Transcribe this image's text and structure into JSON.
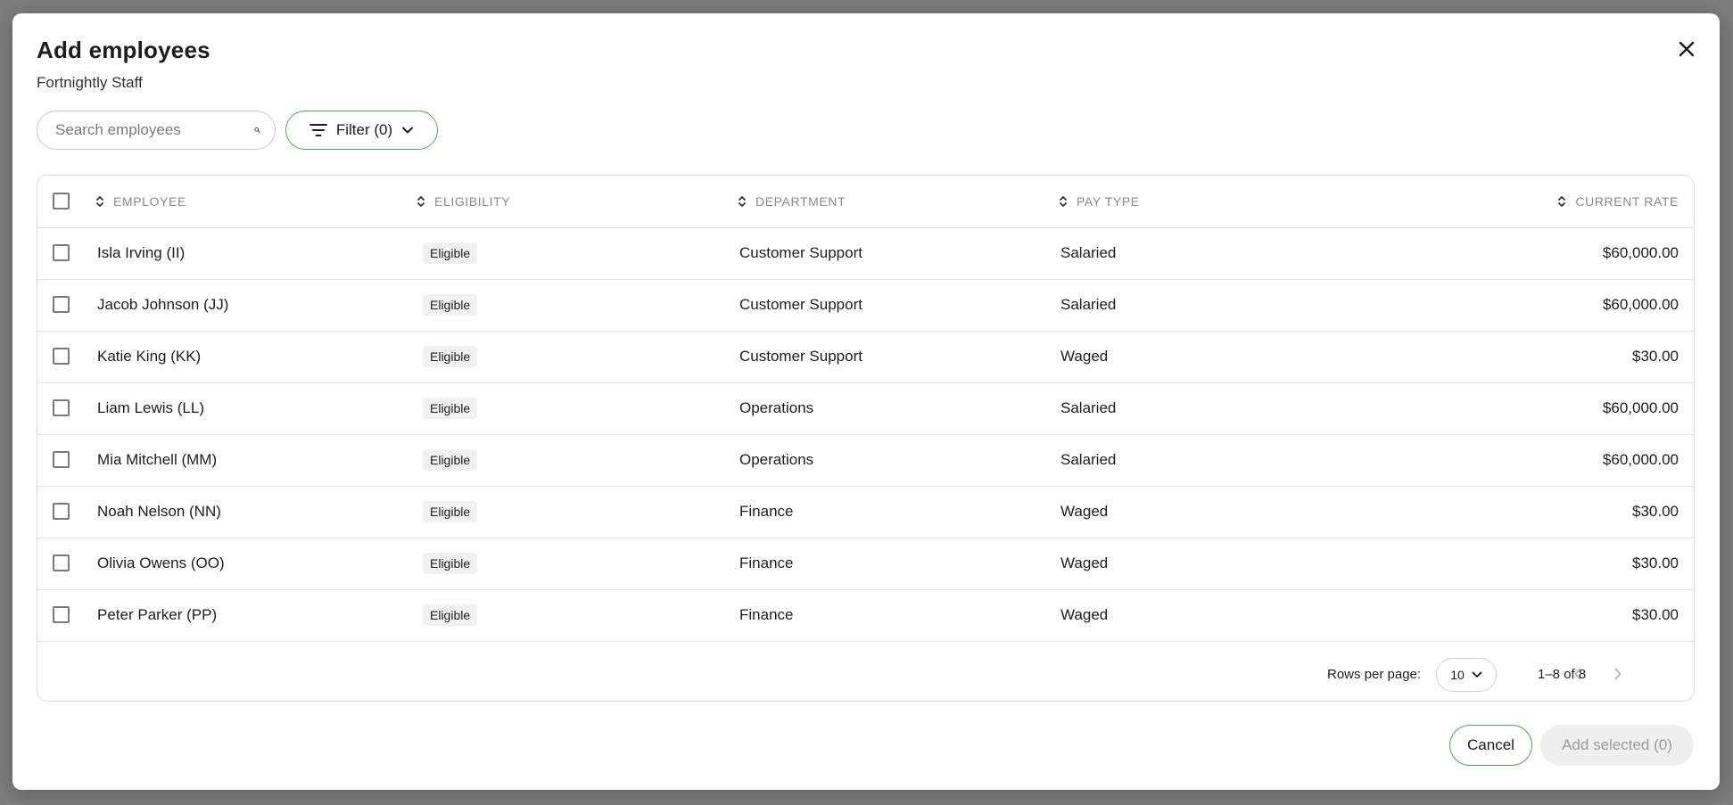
{
  "dialog": {
    "title": "Add employees",
    "subtitle": "Fortnightly Staff"
  },
  "search": {
    "placeholder": "Search employees",
    "value": ""
  },
  "filter": {
    "label": "Filter (0)"
  },
  "table": {
    "columns": [
      {
        "key": "employee",
        "label": "EMPLOYEE"
      },
      {
        "key": "eligibility",
        "label": "ELIGIBILITY"
      },
      {
        "key": "department",
        "label": "DEPARTMENT"
      },
      {
        "key": "pay_type",
        "label": "PAY TYPE"
      },
      {
        "key": "current_rate",
        "label": "CURRENT RATE"
      }
    ],
    "rows": [
      {
        "employee": "Isla Irving (II)",
        "eligibility": "Eligible",
        "department": "Customer Support",
        "pay_type": "Salaried",
        "current_rate": "$60,000.00"
      },
      {
        "employee": "Jacob Johnson (JJ)",
        "eligibility": "Eligible",
        "department": "Customer Support",
        "pay_type": "Salaried",
        "current_rate": "$60,000.00"
      },
      {
        "employee": "Katie King (KK)",
        "eligibility": "Eligible",
        "department": "Customer Support",
        "pay_type": "Waged",
        "current_rate": "$30.00"
      },
      {
        "employee": "Liam Lewis (LL)",
        "eligibility": "Eligible",
        "department": "Operations",
        "pay_type": "Salaried",
        "current_rate": "$60,000.00"
      },
      {
        "employee": "Mia Mitchell (MM)",
        "eligibility": "Eligible",
        "department": "Operations",
        "pay_type": "Salaried",
        "current_rate": "$60,000.00"
      },
      {
        "employee": "Noah Nelson (NN)",
        "eligibility": "Eligible",
        "department": "Finance",
        "pay_type": "Waged",
        "current_rate": "$30.00"
      },
      {
        "employee": "Olivia Owens (OO)",
        "eligibility": "Eligible",
        "department": "Finance",
        "pay_type": "Waged",
        "current_rate": "$30.00"
      },
      {
        "employee": "Peter Parker (PP)",
        "eligibility": "Eligible",
        "department": "Finance",
        "pay_type": "Waged",
        "current_rate": "$30.00"
      }
    ]
  },
  "pagination": {
    "rows_per_page_label": "Rows per page:",
    "rows_per_page_value": "10",
    "range_text": "1–8 of 8"
  },
  "actions": {
    "cancel_label": "Cancel",
    "add_selected_label": "Add selected (0)"
  },
  "colors": {
    "accent_green": "#4caf50",
    "overlay": "#7d7d7d",
    "disabled_bg": "#efefef"
  },
  "icons": [
    "close-icon",
    "search-icon",
    "filter-icon",
    "chevron-down-icon",
    "sort-icon",
    "chevron-left-icon",
    "chevron-right-icon"
  ]
}
